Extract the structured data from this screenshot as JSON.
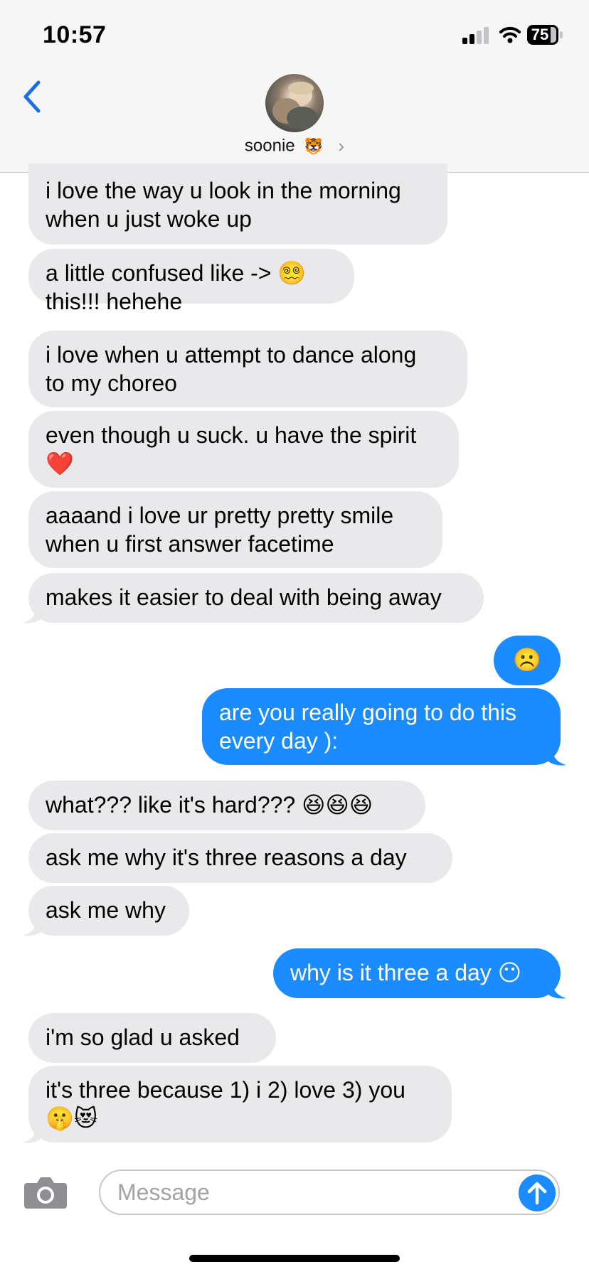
{
  "status_bar": {
    "time": "10:57",
    "battery": "75"
  },
  "header": {
    "contact_name": "soonie",
    "contact_emoji": "🐯",
    "avatar": "photo-avatar"
  },
  "messages": [
    {
      "from": "them",
      "text": "i love the way u look in the morning\nwhen u just woke up"
    },
    {
      "from": "them",
      "text": "a little confused like -> 😵‍💫\nthis!!! hehehe"
    },
    {
      "from": "them",
      "text": "i love when u attempt to dance along\nto my choreo"
    },
    {
      "from": "them",
      "text": "even though u suck. u have the spirit\n❤️"
    },
    {
      "from": "them",
      "text": "aaaand i love ur pretty pretty smile\nwhen u first answer facetime"
    },
    {
      "from": "them",
      "text": "makes it easier to deal with being away"
    },
    {
      "from": "me",
      "text": "☹️"
    },
    {
      "from": "me",
      "text": "are you really going to do this\nevery day ):"
    },
    {
      "from": "them",
      "text": "what??? like it's hard??? 😆😆😆"
    },
    {
      "from": "them",
      "text": "ask me why it's three reasons a day"
    },
    {
      "from": "them",
      "text": "ask me why"
    },
    {
      "from": "me",
      "text": "why is it three a day 😶"
    },
    {
      "from": "them",
      "text": "i'm so glad u asked"
    },
    {
      "from": "them",
      "text": "it's three because 1) i 2) love 3) you\n🤫😻"
    }
  ],
  "composer": {
    "placeholder": "Message"
  },
  "colors": {
    "outgoing_bubble": "#1a8cff",
    "incoming_bubble": "#e9e9eb",
    "accent": "#1a8cff"
  },
  "icons": [
    "back-chevron-icon",
    "camera-icon",
    "send-arrow-icon",
    "cellular-signal-icon",
    "wifi-icon",
    "battery-icon",
    "contact-chevron-icon"
  ]
}
